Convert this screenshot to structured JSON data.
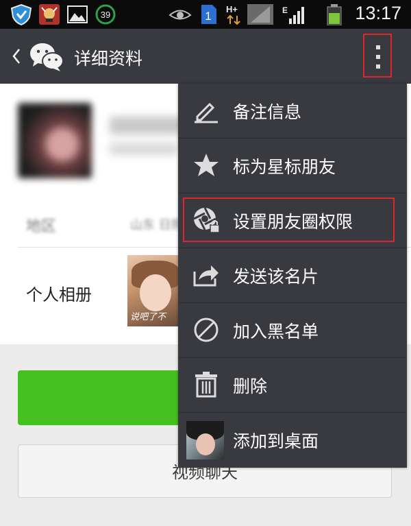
{
  "status_bar": {
    "time": "13:17",
    "notification_badge": "39",
    "sim_label": "1",
    "network_type": "H+",
    "network_type_2": "E",
    "icons": [
      "shield-icon",
      "game-icon",
      "gallery-icon",
      "battery-saver-icon",
      "eye-icon",
      "sim-icon",
      "data-arrows-icon",
      "signal-icon",
      "battery-icon"
    ]
  },
  "action_bar": {
    "title": "详细资料",
    "back_icon": "chevron-left-icon",
    "logo_icon": "wechat-logo-icon",
    "more_icon": "more-vertical-icon"
  },
  "profile": {
    "album_label": "个人相册",
    "album_caption": "说吧了不"
  },
  "buttons": {
    "video_chat": "视频聊天"
  },
  "menu": {
    "items": [
      {
        "label": "备注信息",
        "icon": "pencil-icon"
      },
      {
        "label": "标为星标朋友",
        "icon": "star-icon"
      },
      {
        "label": "设置朋友圈权限",
        "icon": "aperture-lock-icon",
        "highlighted": true
      },
      {
        "label": "发送该名片",
        "icon": "share-icon"
      },
      {
        "label": "加入黑名单",
        "icon": "block-icon"
      },
      {
        "label": "删除",
        "icon": "trash-icon"
      },
      {
        "label": "添加到桌面",
        "icon": "avatar-thumbnail-icon"
      }
    ]
  },
  "colors": {
    "action_bar": "#393a3f",
    "menu": "#393a3f",
    "primary_button": "#44c01f",
    "highlight_frame": "#e0262a"
  }
}
